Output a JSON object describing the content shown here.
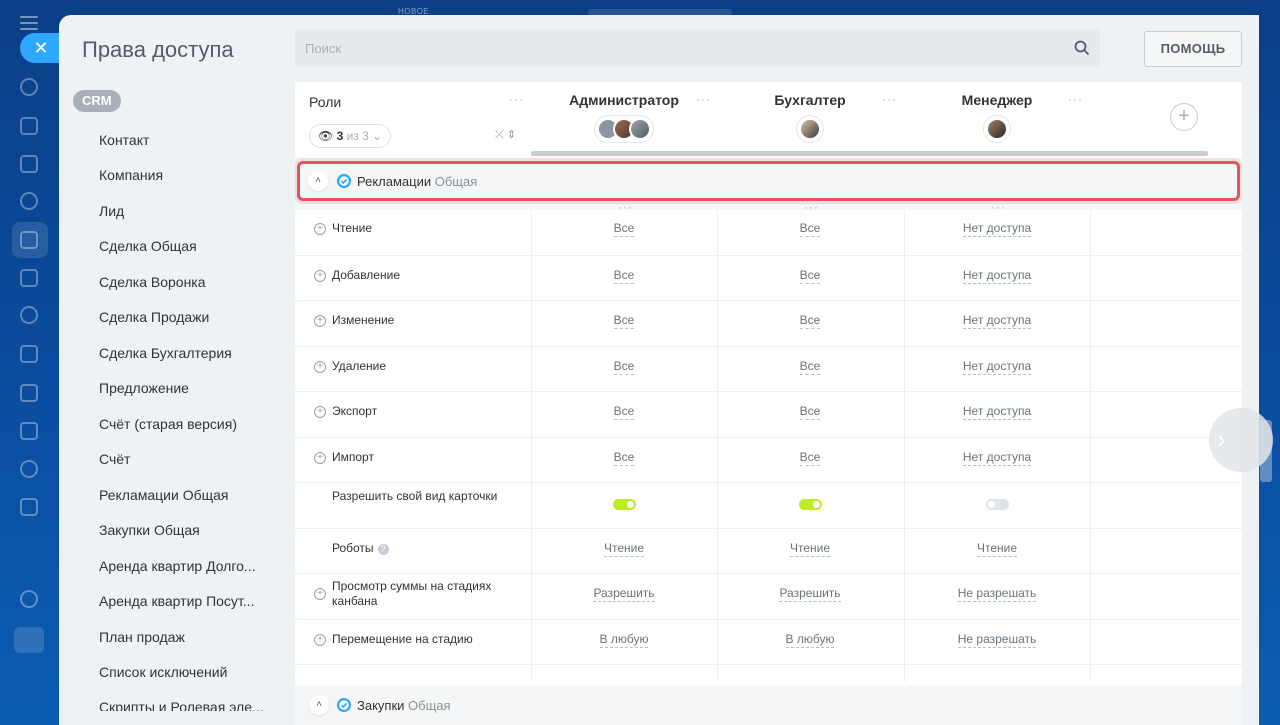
{
  "topbar": {
    "new_label": "НОВОЕ"
  },
  "panel": {
    "title": "Права доступа",
    "search_placeholder": "Поиск",
    "help_label": "ПОМОЩЬ"
  },
  "nav": {
    "badge": "CRM",
    "items": [
      "Контакт",
      "Компания",
      "Лид",
      "Сделка Общая",
      "Сделка Воронка",
      "Сделка Продажи",
      "Сделка Бухгалтерия",
      "Предложение",
      "Счёт (старая версия)",
      "Счёт",
      "Рекламации Общая",
      "Закупки Общая",
      "Аренда квартир Долго...",
      "Аренда квартир Посут...",
      "План продаж",
      "Список исключений",
      "Скрипты и Ролевая эле..."
    ]
  },
  "table": {
    "roles_label": "Роли",
    "view_count": "3",
    "view_of": "из 3",
    "roles": [
      "Администратор",
      "Бухгалтер",
      "Менеджер"
    ],
    "section": {
      "name": "Рекламации",
      "type": "Общая"
    },
    "rows": [
      {
        "label": "Чтение",
        "values": [
          "Все",
          "Все",
          "Нет доступа"
        ],
        "expandable": true
      },
      {
        "label": "Добавление",
        "values": [
          "Все",
          "Все",
          "Нет доступа"
        ],
        "expandable": true
      },
      {
        "label": "Изменение",
        "values": [
          "Все",
          "Все",
          "Нет доступа"
        ],
        "expandable": true
      },
      {
        "label": "Удаление",
        "values": [
          "Все",
          "Все",
          "Нет доступа"
        ],
        "expandable": true
      },
      {
        "label": "Экспорт",
        "values": [
          "Все",
          "Все",
          "Нет доступа"
        ],
        "expandable": true
      },
      {
        "label": "Импорт",
        "values": [
          "Все",
          "Все",
          "Нет доступа"
        ],
        "expandable": true
      },
      {
        "label": "Разрешить свой вид карточки",
        "toggles": [
          true,
          true,
          false
        ],
        "expandable": false
      },
      {
        "label": "Роботы",
        "values": [
          "Чтение",
          "Чтение",
          "Чтение"
        ],
        "expandable": false,
        "help": true
      },
      {
        "label": "Просмотр суммы на стадиях канбана",
        "values": [
          "Разрешить",
          "Разрешить",
          "Не разрешать"
        ],
        "expandable": true
      },
      {
        "label": "Перемещение на стадию",
        "values": [
          "В любую",
          "В любую",
          "Не разрешать"
        ],
        "expandable": true
      }
    ],
    "next_section": {
      "name": "Закупки",
      "type": "Общая"
    }
  },
  "colors": {
    "accent": "#2fa7ff",
    "toggle_on": "#bbed21",
    "highlight": "#e5545e"
  }
}
